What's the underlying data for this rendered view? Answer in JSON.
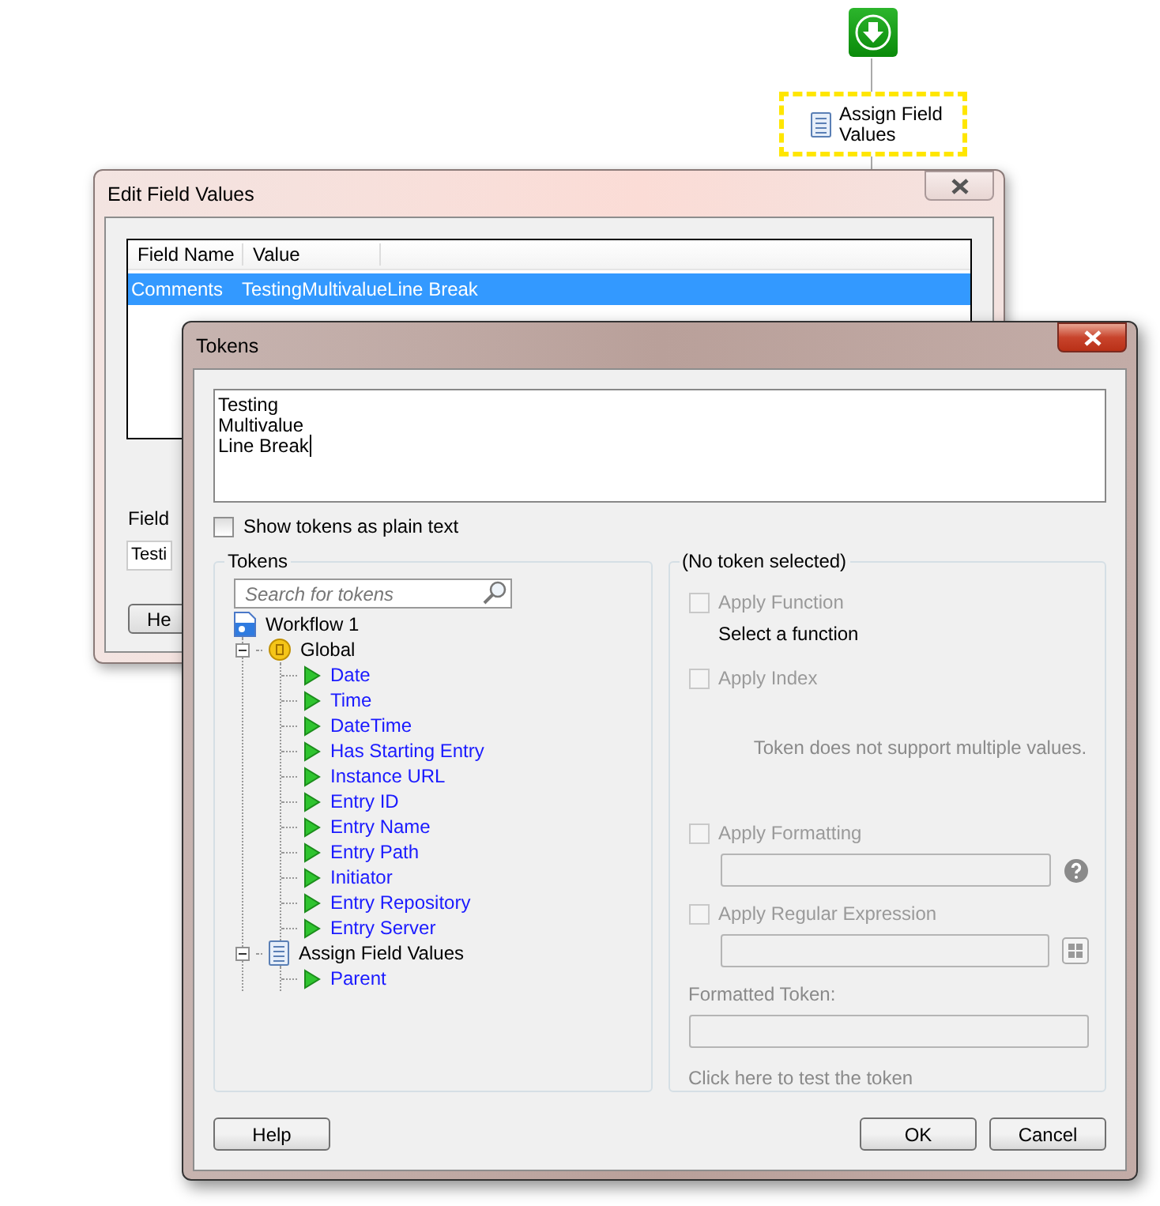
{
  "workflow": {
    "activity": {
      "label": "Assign Field Values",
      "selected": true
    }
  },
  "edit_window": {
    "title": "Edit Field Values",
    "columns": [
      "Field Name",
      "Value"
    ],
    "rows": [
      {
        "cells": [
          "Comments",
          "TestingMultivalueLine Break"
        ],
        "selected": true
      }
    ],
    "group_label": "Field",
    "field_value": "Testi",
    "help_button": "He"
  },
  "tokens_dialog": {
    "title": "Tokens",
    "editor_lines": [
      "Testing",
      "Multivalue",
      "Line Break"
    ],
    "plain_text": {
      "label": "Show tokens as plain text",
      "checked": false
    },
    "tokens_group": {
      "label": "Tokens",
      "search": {
        "placeholder": "Search for tokens"
      },
      "tree": [
        {
          "label": "Workflow 1",
          "kind": "workflow",
          "children": [
            {
              "label": "Global",
              "kind": "global",
              "expanded": true,
              "children": [
                {
                  "label": "Date",
                  "kind": "token"
                },
                {
                  "label": "Time",
                  "kind": "token"
                },
                {
                  "label": "DateTime",
                  "kind": "token"
                },
                {
                  "label": "Has Starting Entry",
                  "kind": "token"
                },
                {
                  "label": "Instance URL",
                  "kind": "token"
                },
                {
                  "label": "Entry ID",
                  "kind": "token"
                },
                {
                  "label": "Entry Name",
                  "kind": "token"
                },
                {
                  "label": "Entry Path",
                  "kind": "token"
                },
                {
                  "label": "Initiator",
                  "kind": "token"
                },
                {
                  "label": "Entry Repository",
                  "kind": "token"
                },
                {
                  "label": "Entry Server",
                  "kind": "token"
                }
              ]
            },
            {
              "label": "Assign Field Values",
              "kind": "activity",
              "expanded": true,
              "children": [
                {
                  "label": "Parent",
                  "kind": "token"
                }
              ]
            }
          ]
        }
      ]
    },
    "options_group": {
      "label": "(No token selected)",
      "items": [
        {
          "kind": "checkbox",
          "label": "Apply Function",
          "checked": false,
          "disabled": true
        },
        {
          "kind": "hint",
          "text": "Select a function"
        },
        {
          "kind": "checkbox",
          "label": "Apply Index",
          "checked": false,
          "disabled": true
        },
        {
          "kind": "note",
          "text": "Token does not support multiple values."
        },
        {
          "kind": "checkbox",
          "label": "Apply Formatting",
          "checked": false,
          "disabled": true
        },
        {
          "kind": "help_field"
        },
        {
          "kind": "checkbox",
          "label": "Apply Regular Expression",
          "checked": false,
          "disabled": true
        },
        {
          "kind": "picker_field"
        },
        {
          "kind": "label",
          "text": "Formatted Token:"
        },
        {
          "kind": "field"
        },
        {
          "kind": "link",
          "text": "Click here to test the token"
        }
      ]
    },
    "buttons": {
      "help": "Help",
      "ok": "OK",
      "cancel": "Cancel"
    }
  }
}
